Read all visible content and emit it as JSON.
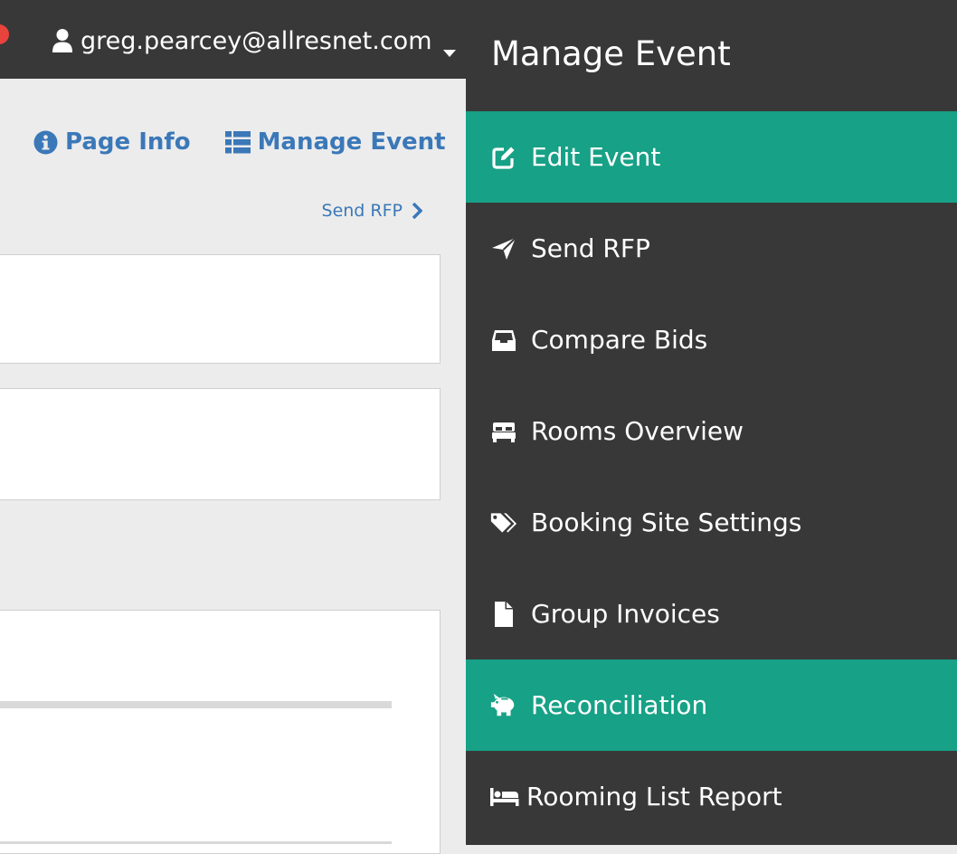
{
  "header": {
    "user_email": "greg.pearcey@allresnet.com"
  },
  "page_actions": {
    "page_info_label": "Page Info",
    "manage_event_label": "Manage Event"
  },
  "breadcrumb_next": {
    "label": "Send RFP"
  },
  "sidebar": {
    "title": "Manage Event",
    "items": [
      {
        "label": "Edit Event",
        "icon": "edit-icon",
        "active": true
      },
      {
        "label": "Send RFP",
        "icon": "paper-plane-icon",
        "active": false
      },
      {
        "label": "Compare Bids",
        "icon": "inbox-icon",
        "active": false
      },
      {
        "label": "Rooms Overview",
        "icon": "bed-front-icon",
        "active": false
      },
      {
        "label": "Booking Site Settings",
        "icon": "tags-icon",
        "active": false
      },
      {
        "label": "Group Invoices",
        "icon": "file-icon",
        "active": false
      },
      {
        "label": "Reconciliation",
        "icon": "piggy-bank-icon",
        "active": true
      },
      {
        "label": "Rooming List Report",
        "icon": "bed-icon",
        "active": false
      }
    ]
  },
  "colors": {
    "sidebar_bg": "#383838",
    "active_item": "#17a186",
    "link": "#3b78b8",
    "page_bg": "#ececec",
    "notification": "#e8433c"
  }
}
